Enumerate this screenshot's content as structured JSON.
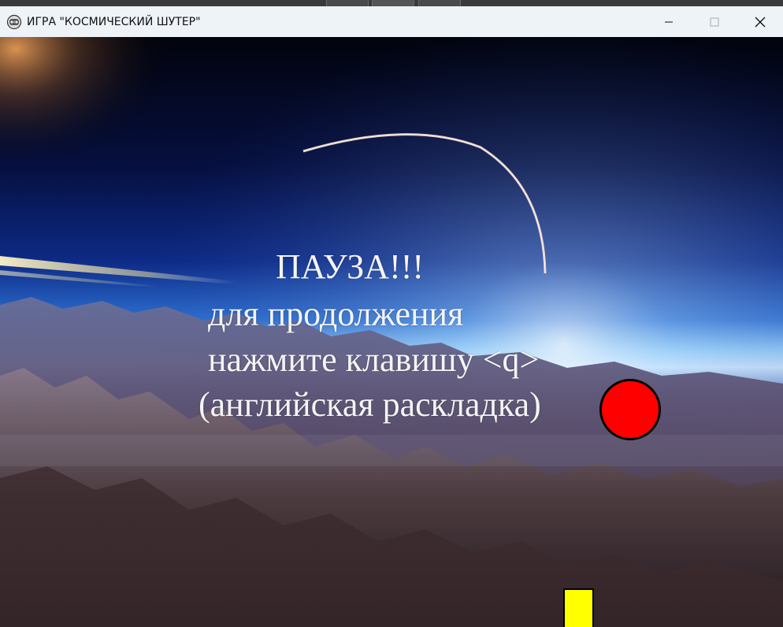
{
  "window": {
    "title": "ИГРА \"КОСМИЧЕСКИЙ ШУТЕР\"",
    "icon": "game-controller-icon",
    "controls": {
      "minimize": "minimize-icon",
      "maximize": "maximize-icon",
      "close": "close-icon"
    }
  },
  "game": {
    "background": "space-mountains-planet",
    "pause_overlay": {
      "line1": "ПАУЗА!!!",
      "line2": "для продолжения",
      "line3": "нажмите клавишу <q>",
      "line4": "(английская раскладка)"
    },
    "enemy": {
      "shape": "circle",
      "color": "#ff0000"
    },
    "player": {
      "shape": "rectangle",
      "color": "#ffff00"
    }
  }
}
